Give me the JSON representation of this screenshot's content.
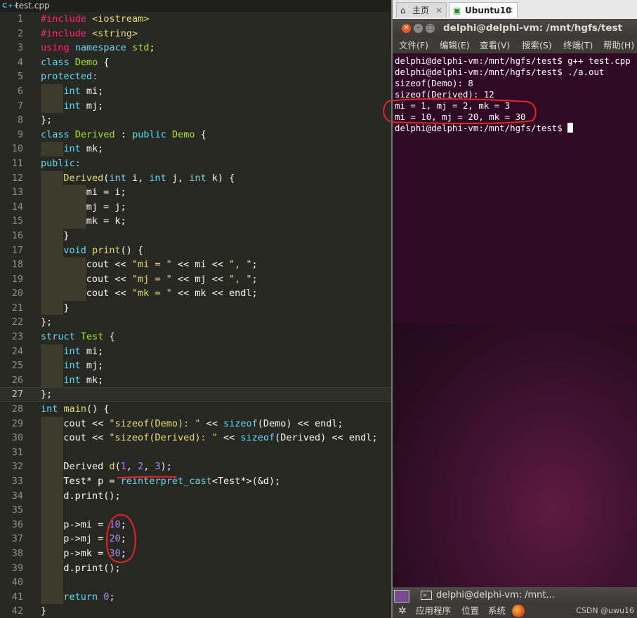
{
  "editor": {
    "file_tab": "test.cpp",
    "file_icon": "C++",
    "lines": [
      {
        "n": "1",
        "ind": 0,
        "t": [
          [
            "pre",
            "#include "
          ],
          [
            "str",
            "<iostream>"
          ]
        ]
      },
      {
        "n": "2",
        "ind": 0,
        "t": [
          [
            "pre",
            "#include "
          ],
          [
            "str",
            "<string>"
          ]
        ]
      },
      {
        "n": "3",
        "ind": 0,
        "t": [
          [
            "pre",
            "using "
          ],
          [
            "kw",
            "namespace "
          ],
          [
            "ty",
            "std"
          ],
          [
            "",
            "; "
          ]
        ]
      },
      {
        "n": "4",
        "ind": 0,
        "t": [
          [
            "kw",
            "class "
          ],
          [
            "ty",
            "Demo "
          ],
          [
            "",
            "{"
          ]
        ]
      },
      {
        "n": "5",
        "ind": 0,
        "t": [
          [
            "kw",
            "protected:"
          ]
        ]
      },
      {
        "n": "6",
        "ind": 1,
        "t": [
          [
            "kw",
            "int "
          ],
          [
            "",
            "mi;"
          ]
        ]
      },
      {
        "n": "7",
        "ind": 1,
        "t": [
          [
            "kw",
            "int "
          ],
          [
            "",
            "mj;"
          ]
        ]
      },
      {
        "n": "8",
        "ind": 0,
        "t": [
          [
            "",
            "};"
          ]
        ]
      },
      {
        "n": "9",
        "ind": 0,
        "t": [
          [
            "kw",
            "class "
          ],
          [
            "ty",
            "Derived "
          ],
          [
            "",
            ": "
          ],
          [
            "kw",
            "public "
          ],
          [
            "ty",
            "Demo "
          ],
          [
            "",
            "{"
          ]
        ]
      },
      {
        "n": "10",
        "ind": 1,
        "t": [
          [
            "kw",
            "int "
          ],
          [
            "",
            "mk;"
          ]
        ]
      },
      {
        "n": "11",
        "ind": 0,
        "t": [
          [
            "kw",
            "public:"
          ]
        ]
      },
      {
        "n": "12",
        "ind": 1,
        "t": [
          [
            "fn",
            "Derived"
          ],
          [
            "",
            "("
          ],
          [
            "kw",
            "int "
          ],
          [
            "",
            "i, "
          ],
          [
            "kw",
            "int "
          ],
          [
            "",
            "j, "
          ],
          [
            "kw",
            "int "
          ],
          [
            "",
            "k) {"
          ]
        ]
      },
      {
        "n": "13",
        "ind": 2,
        "t": [
          [
            "",
            "mi = i;"
          ]
        ]
      },
      {
        "n": "14",
        "ind": 2,
        "t": [
          [
            "",
            "mj = j;"
          ]
        ]
      },
      {
        "n": "15",
        "ind": 2,
        "t": [
          [
            "",
            "mk = k;"
          ]
        ]
      },
      {
        "n": "16",
        "ind": 1,
        "t": [
          [
            "",
            "}"
          ]
        ]
      },
      {
        "n": "17",
        "ind": 1,
        "t": [
          [
            "kw",
            "void "
          ],
          [
            "fn",
            "print"
          ],
          [
            "",
            "() {"
          ]
        ]
      },
      {
        "n": "18",
        "ind": 2,
        "t": [
          [
            "",
            "cout << "
          ],
          [
            "str",
            "\"mi = \""
          ],
          [
            "",
            " << mi << "
          ],
          [
            "str",
            "\", \""
          ],
          [
            "",
            ";"
          ]
        ]
      },
      {
        "n": "19",
        "ind": 2,
        "t": [
          [
            "",
            "cout << "
          ],
          [
            "str",
            "\"mj = \""
          ],
          [
            "",
            " << mj << "
          ],
          [
            "str",
            "\", \""
          ],
          [
            "",
            ";"
          ]
        ]
      },
      {
        "n": "20",
        "ind": 2,
        "t": [
          [
            "",
            "cout << "
          ],
          [
            "str",
            "\"mk = \""
          ],
          [
            "",
            " << mk << endl;"
          ]
        ]
      },
      {
        "n": "21",
        "ind": 1,
        "t": [
          [
            "",
            "}"
          ]
        ]
      },
      {
        "n": "22",
        "ind": 0,
        "t": [
          [
            "",
            "};"
          ]
        ]
      },
      {
        "n": "23",
        "ind": 0,
        "t": [
          [
            "kw",
            "struct "
          ],
          [
            "ty",
            "Test "
          ],
          [
            "",
            "{"
          ]
        ]
      },
      {
        "n": "24",
        "ind": 1,
        "t": [
          [
            "kw",
            "int "
          ],
          [
            "",
            "mi;"
          ]
        ]
      },
      {
        "n": "25",
        "ind": 1,
        "t": [
          [
            "kw",
            "int "
          ],
          [
            "",
            "mj;"
          ]
        ]
      },
      {
        "n": "26",
        "ind": 1,
        "t": [
          [
            "kw",
            "int "
          ],
          [
            "",
            "mk;"
          ]
        ]
      },
      {
        "n": "27",
        "ind": 0,
        "cur": true,
        "t": [
          [
            "",
            "};"
          ]
        ]
      },
      {
        "n": "28",
        "ind": 0,
        "t": [
          [
            "kw",
            "int "
          ],
          [
            "fn",
            "main"
          ],
          [
            "",
            "() {"
          ]
        ]
      },
      {
        "n": "29",
        "ind": 1,
        "t": [
          [
            "",
            "cout << "
          ],
          [
            "str",
            "\"sizeof(Demo): \""
          ],
          [
            "",
            " << "
          ],
          [
            "kw",
            "sizeof"
          ],
          [
            "",
            "(Demo) << endl;"
          ]
        ]
      },
      {
        "n": "30",
        "ind": 1,
        "t": [
          [
            "",
            "cout << "
          ],
          [
            "str",
            "\"sizeof(Derived): \""
          ],
          [
            "",
            " << "
          ],
          [
            "kw",
            "sizeof"
          ],
          [
            "",
            "(Derived) << endl;"
          ]
        ]
      },
      {
        "n": "31",
        "ind": 1,
        "t": []
      },
      {
        "n": "32",
        "ind": 1,
        "t": [
          [
            "",
            "Derived "
          ],
          [
            "fn",
            "d"
          ],
          [
            "",
            "("
          ],
          [
            "num",
            "1"
          ],
          [
            "",
            ", "
          ],
          [
            "num",
            "2"
          ],
          [
            "",
            ", "
          ],
          [
            "num",
            "3"
          ],
          [
            "",
            ");"
          ]
        ]
      },
      {
        "n": "33",
        "ind": 1,
        "t": [
          [
            "",
            "Test* p = "
          ],
          [
            "kw",
            "reinterpret_cast"
          ],
          [
            "",
            "<Test*>(&d);"
          ]
        ]
      },
      {
        "n": "34",
        "ind": 1,
        "t": [
          [
            "",
            "d.print();"
          ]
        ]
      },
      {
        "n": "35",
        "ind": 1,
        "t": []
      },
      {
        "n": "36",
        "ind": 1,
        "t": [
          [
            "",
            "p->mi = "
          ],
          [
            "num",
            "10"
          ],
          [
            "",
            ";"
          ]
        ]
      },
      {
        "n": "37",
        "ind": 1,
        "t": [
          [
            "",
            "p->mj = "
          ],
          [
            "num",
            "20"
          ],
          [
            "",
            ";"
          ]
        ]
      },
      {
        "n": "38",
        "ind": 1,
        "t": [
          [
            "",
            "p->mk = "
          ],
          [
            "num",
            "30"
          ],
          [
            "",
            ";"
          ]
        ]
      },
      {
        "n": "39",
        "ind": 1,
        "t": [
          [
            "",
            "d.print();"
          ]
        ]
      },
      {
        "n": "40",
        "ind": 1,
        "t": []
      },
      {
        "n": "41",
        "ind": 1,
        "t": [
          [
            "kw",
            "return "
          ],
          [
            "num",
            "0"
          ],
          [
            "",
            ";"
          ]
        ]
      },
      {
        "n": "42",
        "ind": 0,
        "t": [
          [
            "",
            "}"
          ]
        ]
      }
    ]
  },
  "vm": {
    "tabs": [
      {
        "icon": "⌂",
        "label": "主页",
        "close": "✕",
        "active": false
      },
      {
        "icon": "▣",
        "label": "Ubuntu10",
        "close": "✕",
        "active": true
      }
    ],
    "terminal_title": "delphi@delphi-vm: /mnt/hgfs/test",
    "menu": [
      "文件(F)",
      "编辑(E)",
      "查看(V)",
      "搜索(S)",
      "终端(T)",
      "帮助(H)"
    ],
    "output": [
      "delphi@delphi-vm:/mnt/hgfs/test$ g++ test.cpp",
      "delphi@delphi-vm:/mnt/hgfs/test$ ./a.out",
      "sizeof(Demo): 8",
      "sizeof(Derived): 12",
      "mi = 1, mj = 2, mk = 3",
      "mi = 10, mj = 20, mk = 30",
      "delphi@delphi-vm:/mnt/hgfs/test$ "
    ],
    "taskbar_window": "delphi@delphi-vm: /mnt...",
    "panel_menu": [
      "应用程序",
      "位置",
      "系统"
    ],
    "watermark": "CSDN @uwu16"
  },
  "colors": {
    "keyword": "#66d9ef",
    "type": "#a6e22e",
    "number": "#ae81ff",
    "string": "#e6db74",
    "preproc": "#f92672",
    "annotation": "#e8212b",
    "terminal_bg": "#300a24"
  }
}
